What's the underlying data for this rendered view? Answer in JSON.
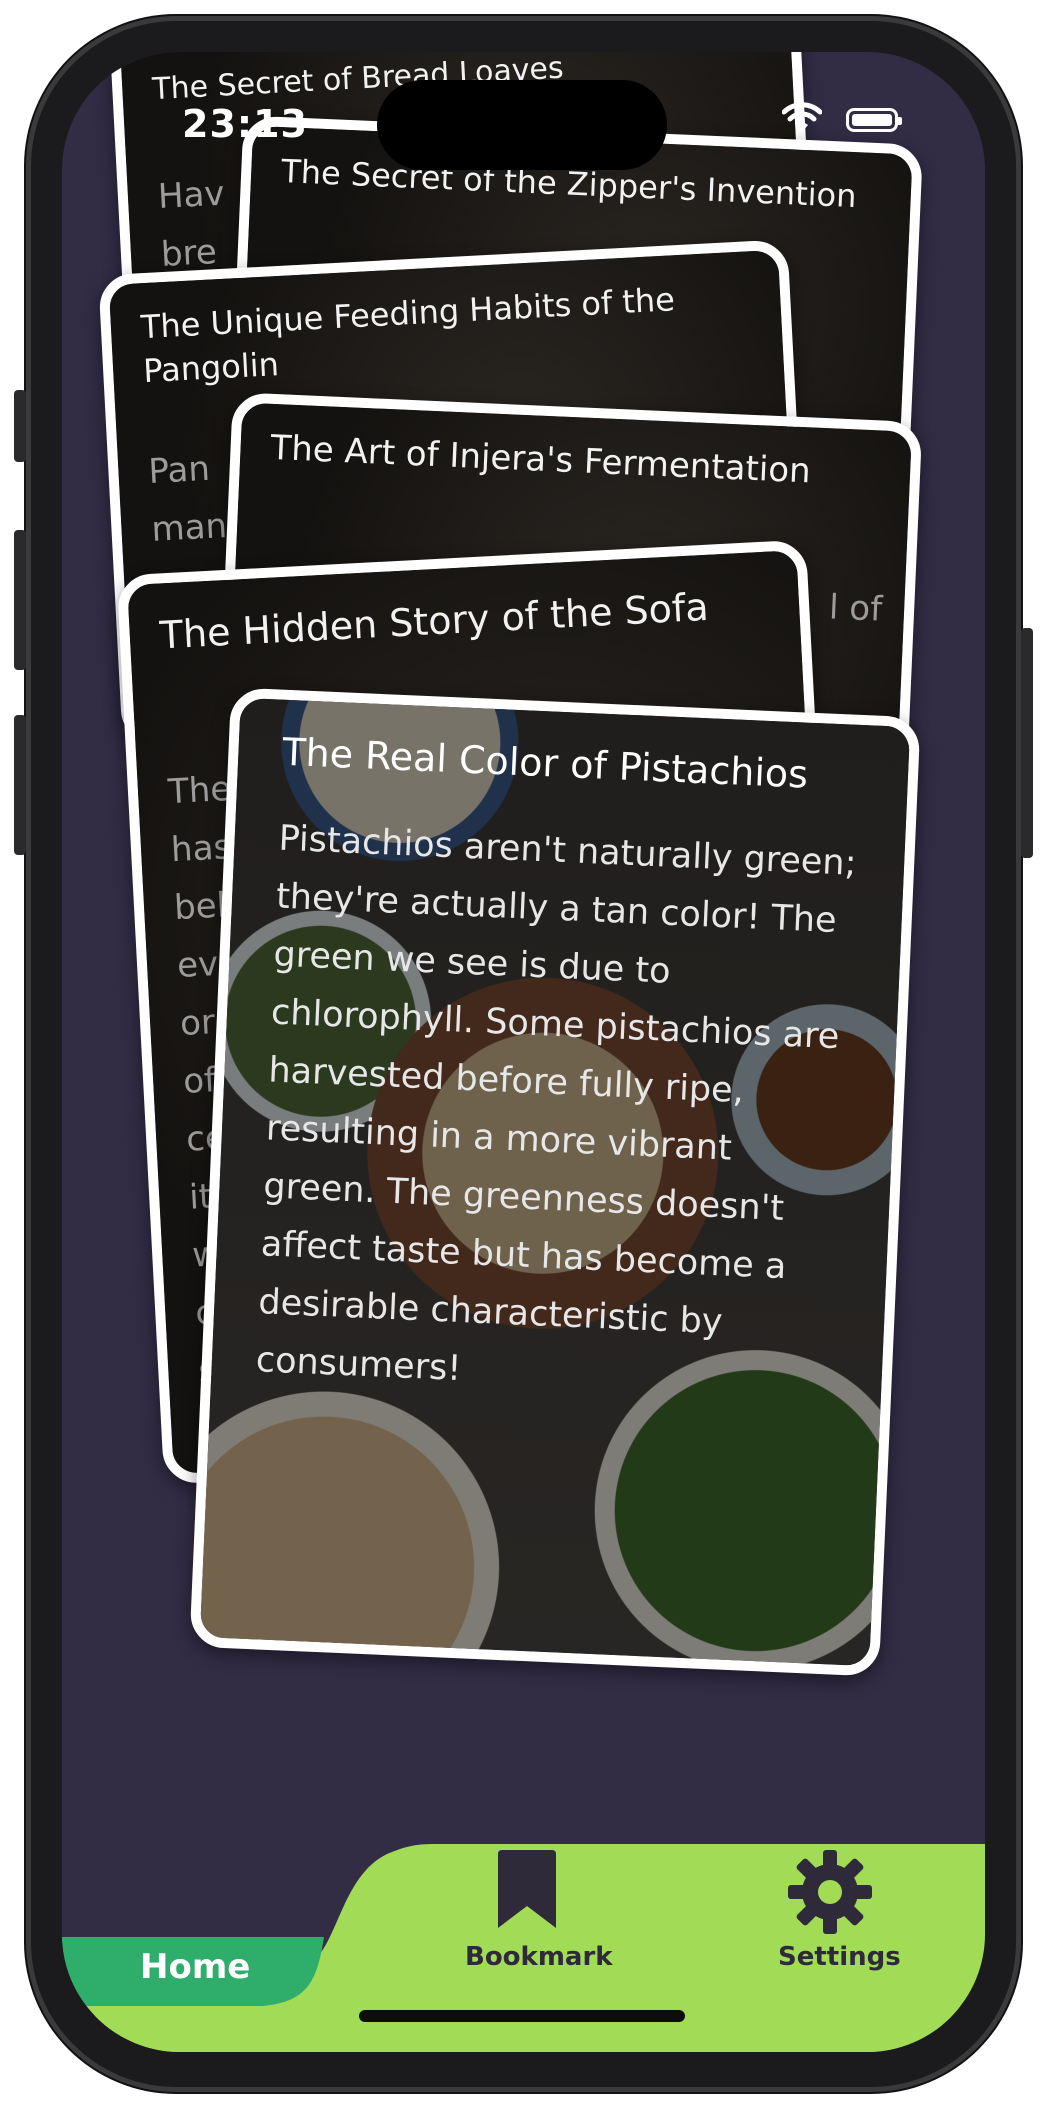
{
  "status_bar": {
    "time": "23:13"
  },
  "cards": [
    {
      "title": "The Secret of Bread Loaves",
      "body_lines": [
        "Hav",
        "bre"
      ]
    },
    {
      "title": "The Secret of the Zipper's Invention",
      "body_lines": []
    },
    {
      "title": "The Unique Feeding Habits of the Pangolin",
      "body_lines": [
        "Pan",
        "man"
      ]
    },
    {
      "title": "The Art of Injera's Fermentation",
      "body_lines": [
        "l of"
      ]
    },
    {
      "title": "The Hidden Story of the Sofa",
      "body_lines": [
        "The",
        "has",
        "beli",
        "evo",
        "or",
        "of",
        "ce",
        "it",
        "w",
        "c",
        "s"
      ]
    },
    {
      "title": "The Real Color of Pistachios",
      "body": "Pistachios aren't naturally green; they're actually a tan color! The green we see is due to chlorophyll. Some pistachios are harvested before fully ripe, resulting in a more vibrant green. The greenness doesn't affect taste but has become a desirable characteristic by consumers!"
    }
  ],
  "tabbar": {
    "colors": {
      "bar": "#a2db55",
      "active": "#2eae6a",
      "icon": "#2f2a3a"
    },
    "tabs": [
      {
        "label": "Home",
        "icon": "home",
        "active": true
      },
      {
        "label": "Bookmark",
        "icon": "bookmark-icon",
        "active": false
      },
      {
        "label": "Settings",
        "icon": "gear-icon",
        "active": false
      }
    ]
  }
}
